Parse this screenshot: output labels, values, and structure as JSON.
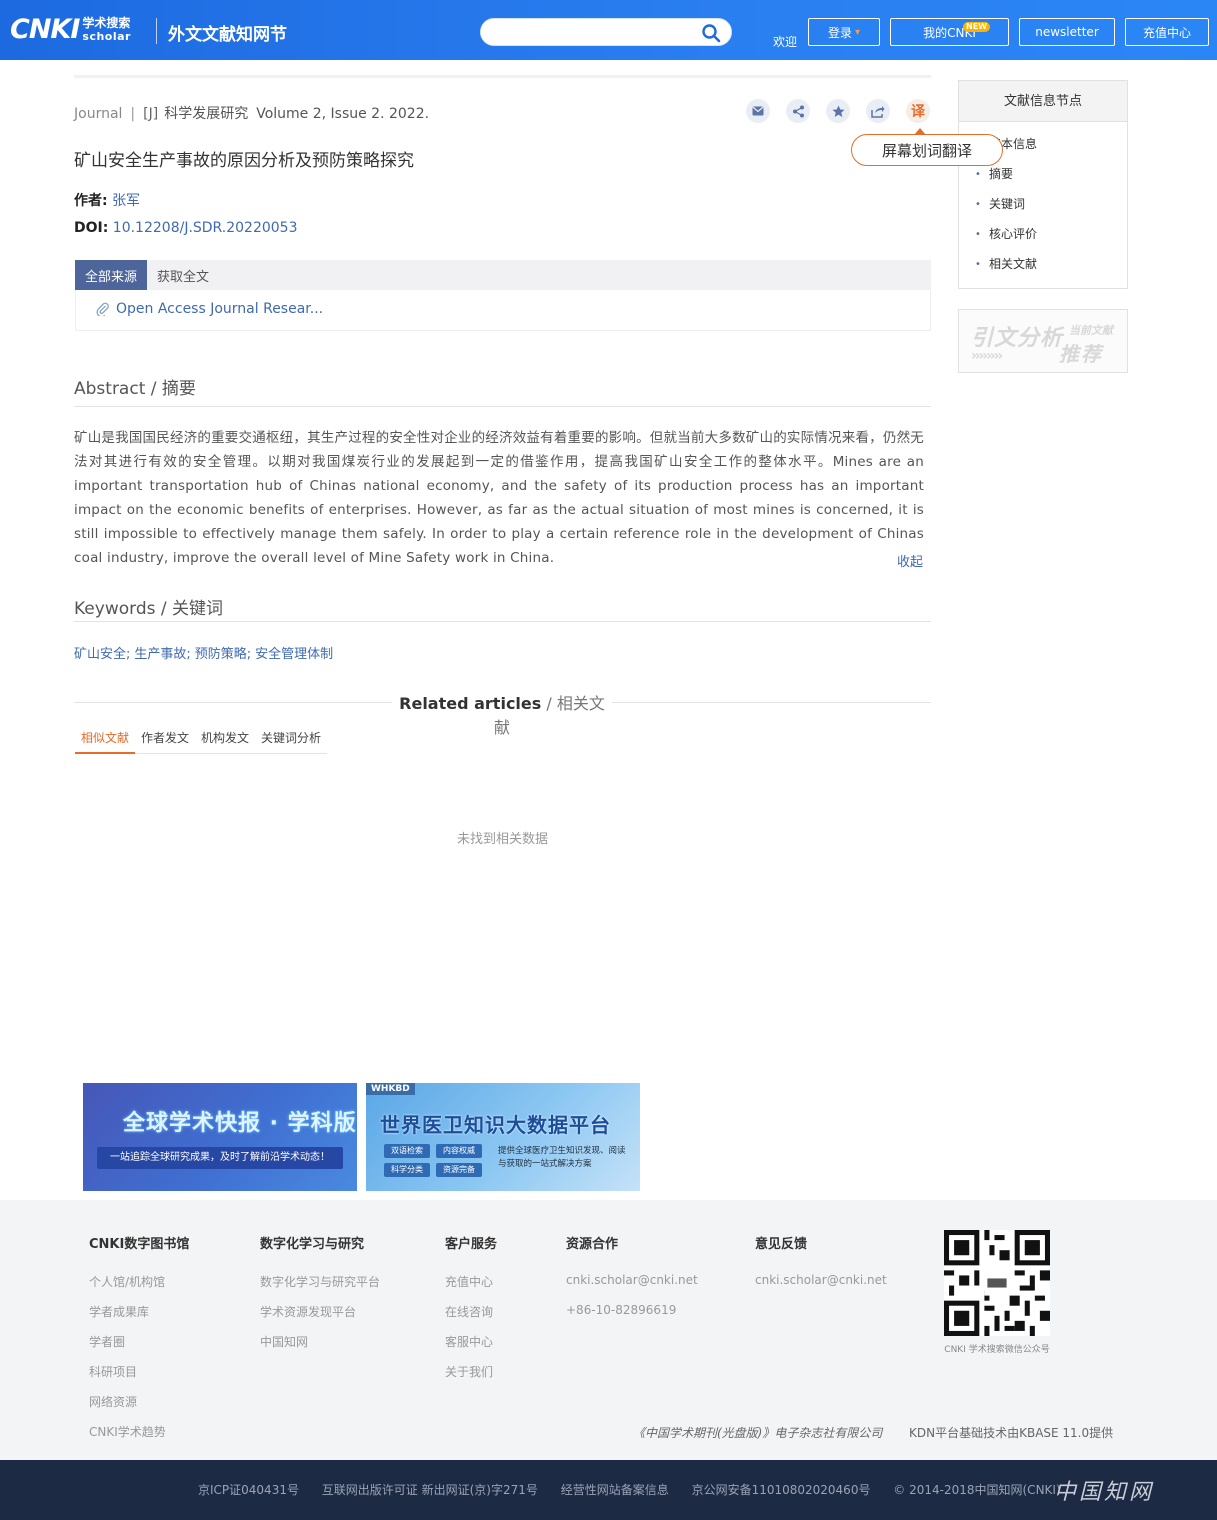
{
  "header": {
    "logo_main": "CNKI",
    "logo_cn": "学术搜索",
    "logo_en": "scholar",
    "site_name": "外文文献知网节",
    "search": {
      "value": "",
      "placeholder": ""
    },
    "welcome": "欢迎",
    "login": "登录",
    "mycnki": "我的CNKI",
    "new_badge": "NEW",
    "newsletter": "newsletter",
    "recharge": "充值中心"
  },
  "article": {
    "type": "Journal",
    "tag": "[J]",
    "journal": "科学发展研究",
    "volume": "Volume 2, Issue 2. 2022.",
    "title": "矿山安全生产事故的原因分析及预防策略探究",
    "author_label": "作者:",
    "author": "张军",
    "doi_label": "DOI:",
    "doi": "10.12208/J.SDR.20220053",
    "tools": {
      "translate": "译",
      "tooltip": "屏幕划词翻译"
    }
  },
  "source": {
    "tabs": [
      "全部来源",
      "获取全文"
    ],
    "link": "Open Access Journal Resear..."
  },
  "abstract": {
    "heading_en": "Abstract",
    "heading_sep": " / ",
    "heading_cn": "摘要",
    "text": "矿山是我国国民经济的重要交通枢纽，其生产过程的安全性对企业的经济效益有着重要的影响。但就当前大多数矿山的实际情况来看，仍然无法对其进行有效的安全管理。以期对我国煤炭行业的发展起到一定的借鉴作用，提高我国矿山安全工作的整体水平。Mines are an important transportation hub of Chinas national economy, and the safety of its production process has an important impact on the economic benefits of enterprises. However, as far as the actual situation of most mines is concerned, it is still impossible to effectively manage them safely. In order to play a certain reference role in the development of Chinas coal industry, improve the overall level of Mine Safety work in China.",
    "collapse": "收起"
  },
  "keywords": {
    "heading_en": "Keywords",
    "heading_sep": " / ",
    "heading_cn": "关键词",
    "items": [
      "矿山安全;",
      "生产事故;",
      "预防策略;",
      "安全管理体制"
    ]
  },
  "related": {
    "title_en": "Related articles",
    "title_sep": " / ",
    "title_cn": "相关文献",
    "tabs": [
      "相似文献",
      "作者发文",
      "机构发文",
      "关键词分析"
    ],
    "empty": "未找到相关数据"
  },
  "banners": {
    "b1_title": "全球学术快报 · 学科版",
    "b1_sub": "一站追踪全球研究成果，及时了解前沿学术动态！",
    "b2_tag": "WHKBD",
    "b2_title": "世界医卫知识大数据平台",
    "b2_chips": [
      "双语检索",
      "内容权威",
      "科学分类",
      "资源完备"
    ],
    "b2_desc": "提供全球医疗卫生知识发现、阅读与获取的一站式解决方案"
  },
  "sidebar": {
    "title": "文献信息节点",
    "items": [
      "基本信息",
      "摘要",
      "关键词",
      "核心评价",
      "相关文献"
    ],
    "cite_big": "引文分析",
    "cite_small": "当前文献",
    "cite_rec": "推荐",
    "cite_arrows": "››››››››"
  },
  "footer": {
    "cols": [
      {
        "title": "CNKI数字图书馆",
        "items": [
          "个人馆/机构馆",
          "学者成果库",
          "学者圈",
          "科研项目",
          "网络资源",
          "CNKI学术趋势"
        ]
      },
      {
        "title": "数字化学习与研究",
        "items": [
          "数字化学习与研究平台",
          "学术资源发现平台",
          "中国知网"
        ]
      },
      {
        "title": "客户服务",
        "items": [
          "充值中心",
          "在线咨询",
          "客服中心",
          "关于我们"
        ]
      },
      {
        "title": "资源合作",
        "items": [
          "cnki.scholar@cnki.net",
          "+86-10-82896619"
        ]
      },
      {
        "title": "意见反馈",
        "items": [
          "cnki.scholar@cnki.net"
        ]
      }
    ],
    "qr_caption": "CNKI 学术搜索微信公众号",
    "publisher": "《中国学术期刊(光盘版)》电子杂志社有限公司",
    "kdn": "KDN平台基础技术由KBASE 11.0提供",
    "bottom": [
      "京ICP证040431号",
      "互联网出版许可证 新出网证(京)字271号",
      "经营性网站备案信息",
      "京公网安备11010802020460号",
      "© 2014-2018中国知网(CNKI)"
    ],
    "bottom_logo": "中国知网"
  }
}
